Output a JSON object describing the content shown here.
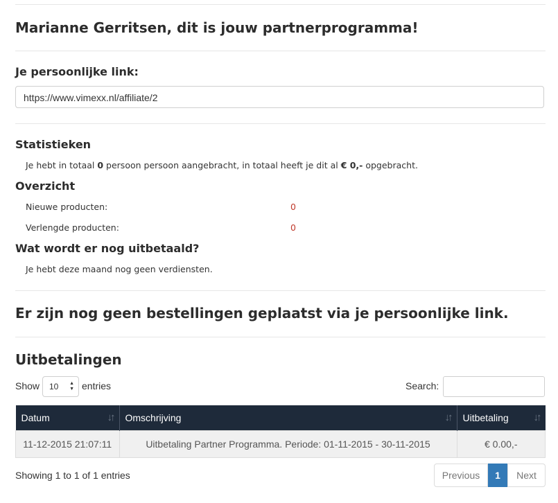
{
  "header": {
    "title": "Marianne Gerritsen, dit is jouw partnerprogramma!"
  },
  "link_section": {
    "heading": "Je persoonlijke link:",
    "link_value": "https://www.vimexx.nl/affiliate/2"
  },
  "statistics": {
    "heading": "Statistieken",
    "text_before": "Je hebt in totaal ",
    "count": "0",
    "text_middle": " persoon persoon aangebracht, in totaal heeft je dit al ",
    "amount": "€ 0,-",
    "text_after": " opgebracht."
  },
  "overview": {
    "heading": "Overzicht",
    "rows": [
      {
        "label": "Nieuwe producten:",
        "value": "0"
      },
      {
        "label": "Verlengde producten:",
        "value": "0"
      }
    ],
    "value_color": "#c0392b"
  },
  "payout_pending": {
    "heading": "Wat wordt er nog uitbetaald?",
    "text": "Je hebt deze maand nog geen verdiensten."
  },
  "orders": {
    "message": "Er zijn nog geen bestellingen geplaatst via je persoonlijke link."
  },
  "payouts": {
    "heading": "Uitbetalingen",
    "show_label": "Show",
    "entries_select": "10",
    "entries_label": "entries",
    "search_label": "Search:",
    "search_value": "",
    "columns": [
      "Datum",
      "Omschrijving",
      "Uitbetaling"
    ],
    "rows": [
      [
        "11-12-2015 21:07:11",
        "Uitbetaling Partner Programma. Periode: 01-11-2015 - 30-11-2015",
        "€ 0.00,-"
      ]
    ],
    "info": "Showing 1 to 1 of 1 entries",
    "pagination": {
      "previous": "Previous",
      "current": "1",
      "next": "Next"
    },
    "header_color": "#1e2a3a",
    "active_page_color": "#337ab7"
  }
}
